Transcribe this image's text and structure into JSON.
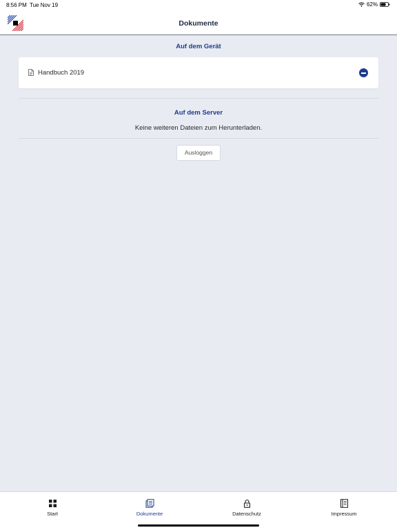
{
  "status_bar": {
    "time": "8:56 PM",
    "date": "Tue Nov 19",
    "battery": "62%"
  },
  "header": {
    "title": "Dokumente",
    "logo": "brand-logo"
  },
  "device_section": {
    "title": "Auf dem Gerät",
    "documents": [
      {
        "label": "Handbuch 2019",
        "icon": "document-icon",
        "action_icon": "remove-icon"
      }
    ]
  },
  "server_section": {
    "title": "Auf dem Server",
    "empty_text": "Keine weiteren Dateien zum Herunterladen."
  },
  "logout_label": "Ausloggen",
  "tabs": [
    {
      "label": "Start",
      "icon": "grid-icon",
      "active": false
    },
    {
      "label": "Dokumente",
      "icon": "documents-icon",
      "active": true
    },
    {
      "label": "Datenschutz",
      "icon": "lock-icon",
      "active": false
    },
    {
      "label": "Impressum",
      "icon": "book-icon",
      "active": false
    }
  ],
  "colors": {
    "accent": "#1f3d8f",
    "background": "#e8ebf1",
    "surface": "#ffffff"
  }
}
